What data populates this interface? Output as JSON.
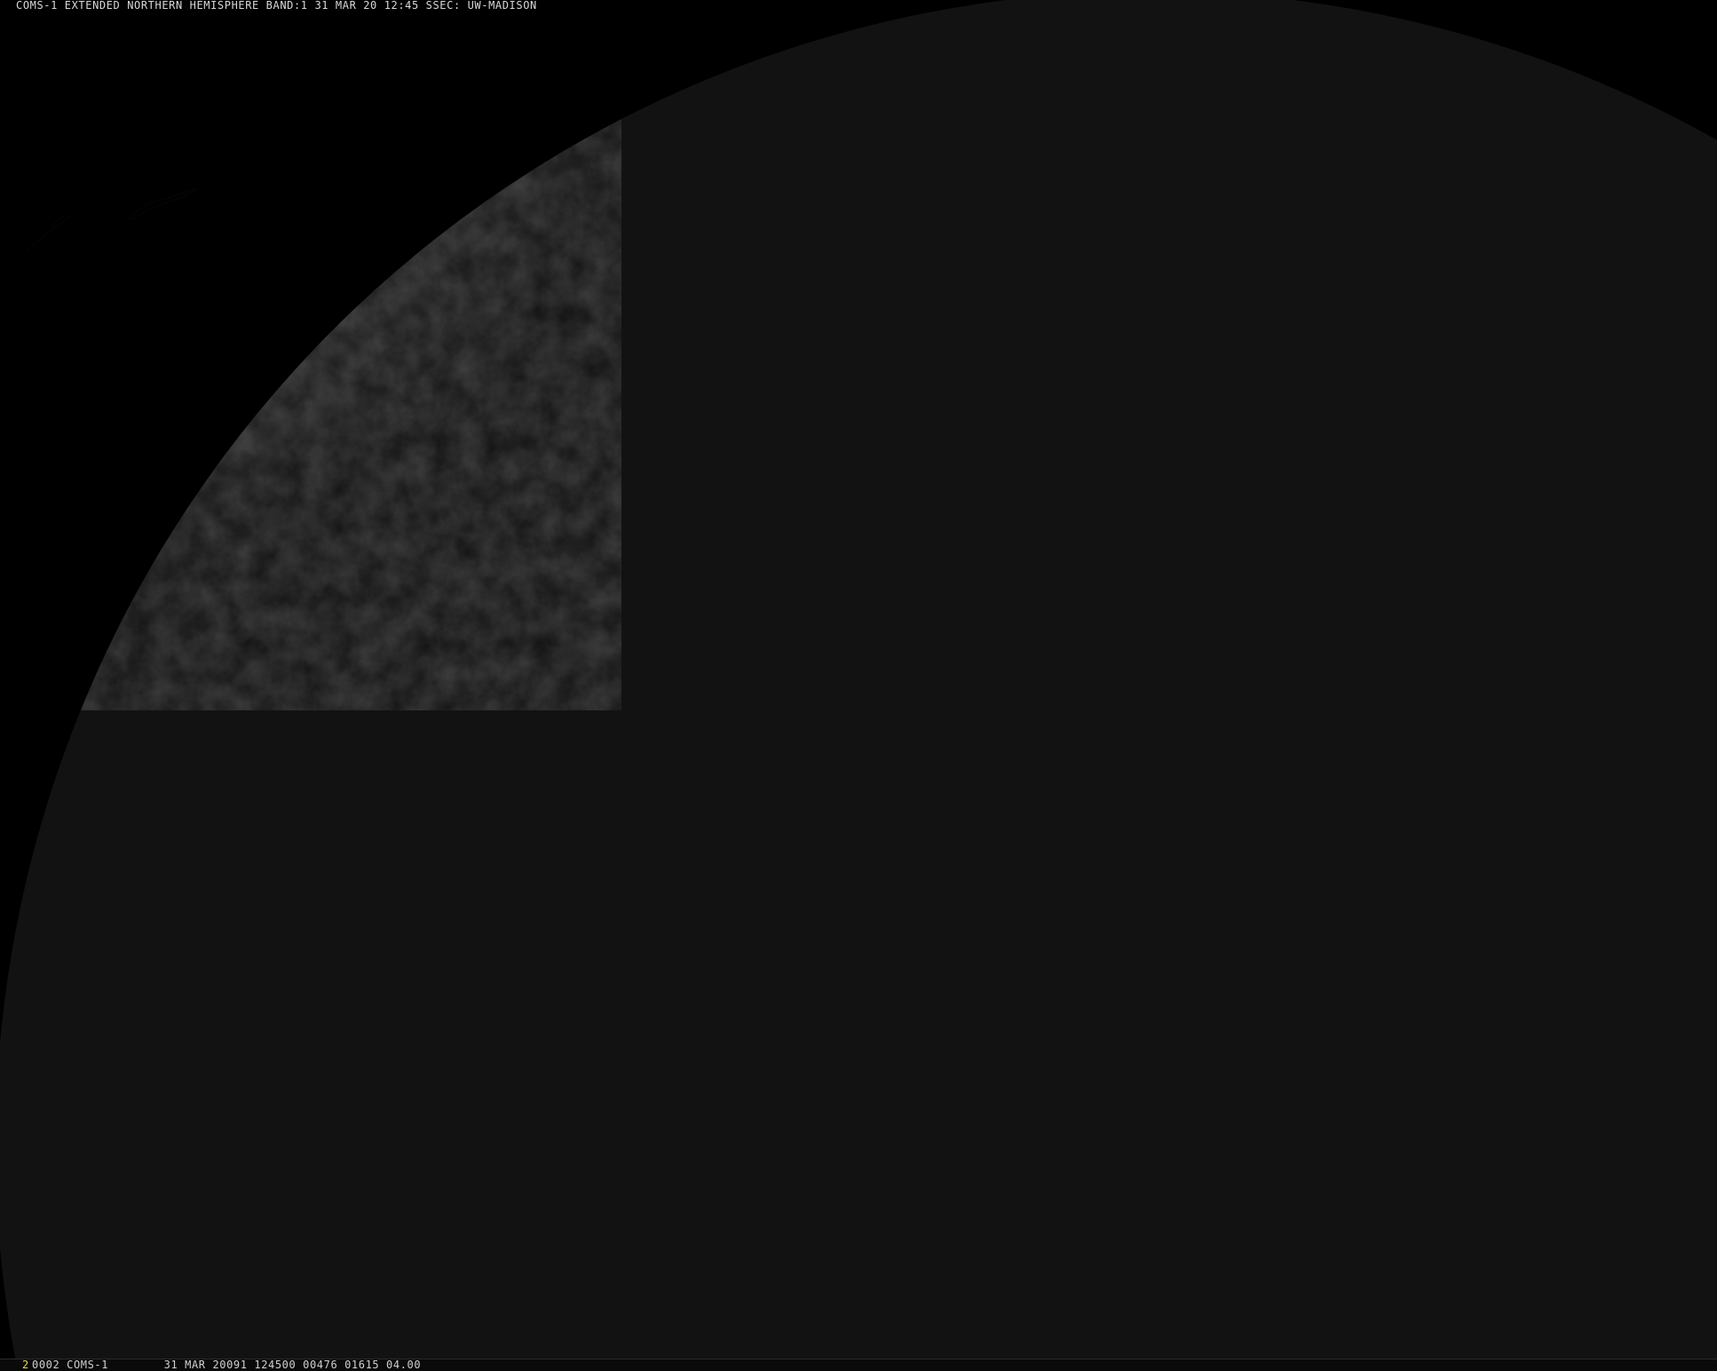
{
  "header": {
    "title": "COMS-1 EXTENDED NORTHERN HEMISPHERE BAND:1 31 MAR 20 12:45 SSEC: UW-MADISON"
  },
  "status_bar": {
    "frame_number": "2",
    "info": "0002 COMS-1        31 MAR 20091 124500 00476 01615 04.00"
  },
  "colors": {
    "background": "#000000",
    "earth_dark": "#121212",
    "earth_lit": "#8a8a8a",
    "frame_number": "#e6d84a",
    "text": "#d8d8d8"
  }
}
